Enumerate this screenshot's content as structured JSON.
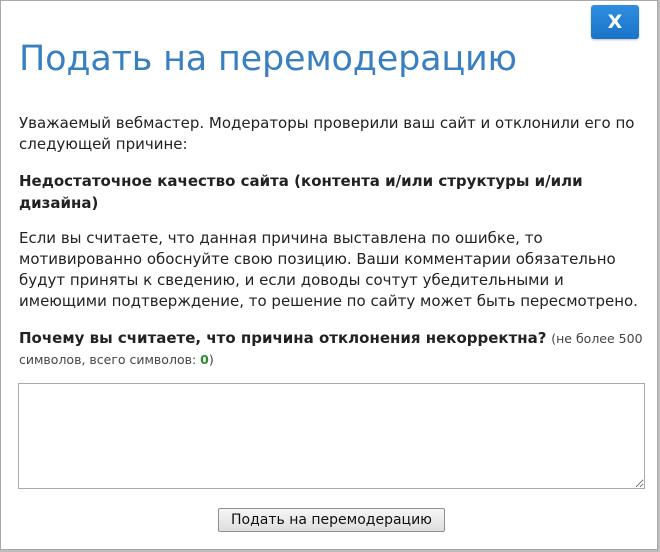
{
  "dialog": {
    "close_label": "X",
    "title": "Подать на перемодерацию",
    "intro": "Уважаемый вебмастер. Модераторы проверили ваш сайт и отклонили его по следующей причине:",
    "reason": "Недостаточное качество сайта (контента и/или структуры и/или дизайна)",
    "explanation": "Если вы считаете, что данная причина выставлена по ошибке, то мотивированно обоснуйте свою позицию. Ваши комментарии обязательно будут приняты к сведению, и если доводы сочтут убедительными и имеющими подтверждение, то решение по сайту может быть пересмотрено.",
    "question": {
      "text": "Почему вы считаете, что причина отклонения некорректна?",
      "note_prefix": "(не более 500 символов, всего символов:",
      "char_count": "0",
      "note_suffix": ")"
    },
    "comment_value": "",
    "submit_label": "Подать на перемодерацию"
  },
  "colors": {
    "title": "#3a7fbf",
    "close_button": "#1a73c8",
    "char_count": "#2e8b2e"
  }
}
